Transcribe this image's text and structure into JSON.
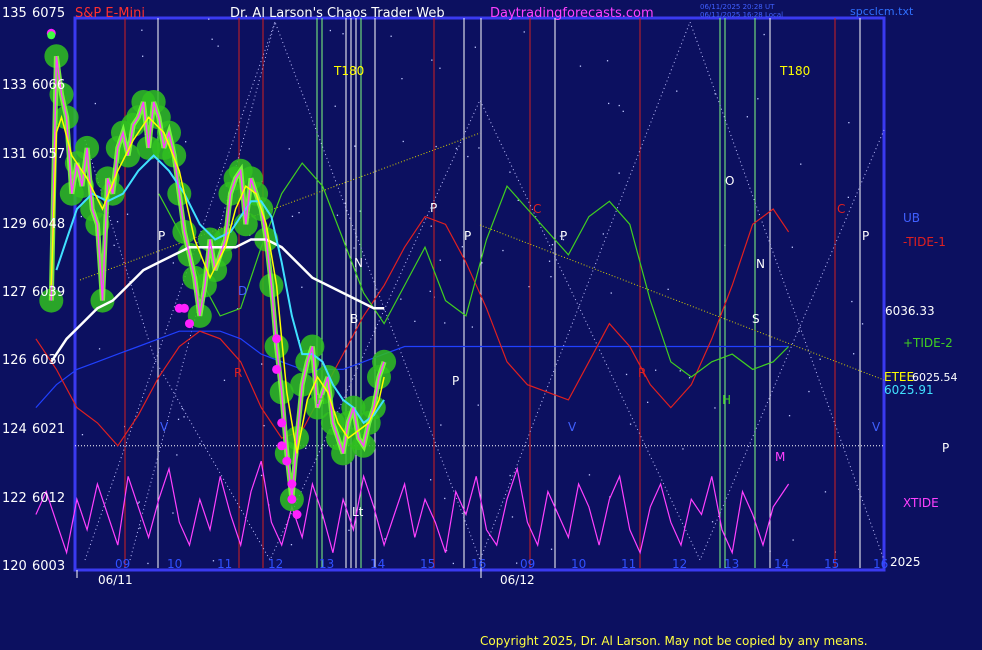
{
  "header": {
    "symbol": "S&P E-Mini",
    "title": "Dr. Al Larson's Chaos Trader Web",
    "site": "Daytradingforecasts.com",
    "stamp_line1": "06/11/2025 20:28 UT",
    "stamp_line2": "06/11/2025 16:28 Local",
    "file_name": "spcclcm.txt"
  },
  "colors": {
    "background": "#0c1060",
    "frame": "#3a3af0",
    "price": "#ff40ff",
    "ema_fast": "#ffff00",
    "ema_mid": "#40e0ff",
    "ema_slow": "#ffffff",
    "tide_minus": "#e02020",
    "tide_plus": "#40d020",
    "ub": "#2040ff",
    "xtide": "#ff40ff",
    "glow": "#30c020",
    "trendline": "#d8d000",
    "copyright": "#ffff40"
  },
  "chart_data": {
    "type": "line",
    "y_left_ticks": [
      "135",
      "133",
      "131",
      "129",
      "127",
      "126",
      "124",
      "122",
      "120"
    ],
    "y_price_ticks": [
      "6075",
      "6066",
      "6057",
      "6048",
      "6039",
      "6030",
      "6021",
      "6012",
      "6003"
    ],
    "ylim": [
      6003,
      6075
    ],
    "x_hour_labels_day1": [
      "09",
      "10",
      "11",
      "12",
      "13",
      "14",
      "15",
      "16"
    ],
    "x_hour_labels_day2": [
      "09",
      "10",
      "11",
      "12",
      "13",
      "14",
      "15",
      "16"
    ],
    "date_labels": [
      "06/11",
      "06/12"
    ],
    "series_labels": [
      "UB",
      "-TIDE-1",
      "+TIDE-2",
      "XTIDE"
    ],
    "value_labels": [
      "6036.33",
      "6025.91",
      "6025.54",
      "2025"
    ],
    "right_label_cluster": "ETEE",
    "marker_labels": [
      "T180",
      "T180",
      "P",
      "P",
      "P",
      "P",
      "P",
      "P",
      "C",
      "C",
      "O",
      "N",
      "N",
      "S",
      "R",
      "R",
      "B",
      "D",
      "H",
      "H",
      "V",
      "V",
      "V",
      "M",
      "P",
      "Lt"
    ],
    "price": {
      "x": [
        9.5,
        9.6,
        9.7,
        9.8,
        9.9,
        10.0,
        10.1,
        10.2,
        10.3,
        10.4,
        10.5,
        10.6,
        10.7,
        10.8,
        10.9,
        11.0,
        11.1,
        11.2,
        11.3,
        11.4,
        11.5,
        11.6,
        11.7,
        11.8,
        11.9,
        12.0,
        12.1,
        12.2,
        12.3,
        12.4,
        12.5,
        12.6,
        12.7,
        12.8,
        12.9,
        13.0,
        13.1,
        13.2,
        13.3,
        13.4,
        13.5,
        13.6,
        13.7,
        13.8,
        13.9,
        14.0,
        14.1,
        14.2,
        14.3,
        14.4,
        14.5,
        14.6,
        14.7,
        14.8,
        14.9,
        15.0,
        15.1,
        15.2,
        15.3,
        15.4,
        15.5,
        15.6,
        15.7,
        15.8,
        15.9,
        16.0
      ],
      "y": [
        6038,
        6070,
        6065,
        6062,
        6052,
        6056,
        6053,
        6058,
        6050,
        6048,
        6038,
        6054,
        6052,
        6058,
        6060,
        6057,
        6061,
        6062,
        6064,
        6058,
        6064,
        6062,
        6058,
        6060,
        6057,
        6052,
        6047,
        6044,
        6041,
        6036,
        6040,
        6046,
        6042,
        6044,
        6046,
        6052,
        6054,
        6055,
        6048,
        6054,
        6052,
        6050,
        6046,
        6040,
        6032,
        6026,
        6018,
        6012,
        6020,
        6027,
        6030,
        6032,
        6024,
        6026,
        6028,
        6022,
        6020,
        6018,
        6022,
        6024,
        6020,
        6019,
        6022,
        6024,
        6028,
        6030
      ]
    },
    "ema_fast": {
      "x": [
        9.5,
        9.6,
        9.7,
        9.9,
        10.2,
        10.5,
        10.8,
        11.1,
        11.4,
        11.7,
        12.0,
        12.3,
        12.6,
        12.9,
        13.1,
        13.3,
        13.5,
        13.7,
        13.9,
        14.1,
        14.3,
        14.5,
        14.7,
        14.9,
        15.1,
        15.3,
        15.5,
        15.7,
        15.9,
        16.0
      ],
      "y": [
        6040,
        6060,
        6062,
        6057,
        6054,
        6050,
        6055,
        6059,
        6062,
        6060,
        6055,
        6046,
        6041,
        6045,
        6050,
        6053,
        6052,
        6048,
        6040,
        6026,
        6018,
        6025,
        6028,
        6026,
        6022,
        6020,
        6021,
        6022,
        6025,
        6028
      ]
    },
    "ema_mid": {
      "x": [
        9.6,
        9.8,
        10.0,
        10.3,
        10.6,
        10.9,
        11.2,
        11.5,
        11.8,
        12.1,
        12.4,
        12.7,
        13.0,
        13.2,
        13.4,
        13.6,
        13.8,
        14.0,
        14.2,
        14.4,
        14.6,
        14.8,
        15.0,
        15.2,
        15.4,
        15.6,
        15.8,
        16.0
      ],
      "y": [
        6042,
        6046,
        6050,
        6052,
        6051,
        6052,
        6055,
        6057,
        6055,
        6052,
        6048,
        6046,
        6047,
        6049,
        6051,
        6051,
        6049,
        6043,
        6036,
        6031,
        6031,
        6030,
        6027,
        6025,
        6024,
        6022,
        6023,
        6025
      ]
    },
    "ema_slow": {
      "x": [
        9.5,
        9.8,
        10.1,
        10.4,
        10.7,
        11.0,
        11.3,
        11.6,
        11.9,
        12.2,
        12.5,
        12.8,
        13.1,
        13.4,
        13.7,
        14.0,
        14.3,
        14.6,
        14.9,
        15.2,
        15.5,
        15.8,
        16.0
      ],
      "y": [
        6030,
        6033,
        6035,
        6037,
        6038,
        6040,
        6042,
        6043,
        6044,
        6045,
        6045,
        6045,
        6045,
        6046,
        6046,
        6045,
        6043,
        6041,
        6040,
        6039,
        6038,
        6037,
        6037
      ]
    },
    "tide_minus": {
      "x": [
        9.2,
        9.6,
        10.0,
        10.4,
        10.8,
        11.2,
        11.6,
        12.0,
        12.4,
        12.8,
        13.2,
        13.6,
        14.0,
        14.4,
        14.8,
        15.2,
        15.6,
        16.0,
        16.4,
        16.8,
        17.2,
        17.6,
        18.0,
        18.4,
        18.8,
        19.2,
        19.6,
        20.0,
        20.4,
        20.8,
        21.2,
        21.6,
        22.0,
        22.4,
        22.8,
        23.2,
        23.6,
        23.9
      ],
      "y": [
        6033,
        6029,
        6024,
        6022,
        6019,
        6023,
        6028,
        6032,
        6034,
        6033,
        6030,
        6024,
        6020,
        6021,
        6026,
        6031,
        6036,
        6040,
        6045,
        6049,
        6048,
        6043,
        6037,
        6030,
        6027,
        6026,
        6025,
        6030,
        6035,
        6032,
        6027,
        6024,
        6027,
        6033,
        6040,
        6048,
        6050,
        6047
      ]
    },
    "tide_plus": {
      "x": [
        11.6,
        12.0,
        12.4,
        12.8,
        13.2,
        13.6,
        14.0,
        14.4,
        14.8,
        15.2,
        15.6,
        16.0,
        16.4,
        16.8,
        17.2,
        17.6,
        18.0,
        18.4,
        18.8,
        19.2,
        19.6,
        20.0,
        20.4,
        20.8,
        21.2,
        21.6,
        22.0,
        22.4,
        22.8,
        23.2,
        23.6,
        23.9
      ],
      "y": [
        6052,
        6047,
        6041,
        6036,
        6037,
        6045,
        6052,
        6056,
        6053,
        6046,
        6039,
        6035,
        6040,
        6045,
        6038,
        6036,
        6046,
        6053,
        6050,
        6047,
        6044,
        6049,
        6051,
        6048,
        6038,
        6030,
        6028,
        6030,
        6031,
        6029,
        6030,
        6032
      ]
    },
    "ub": {
      "x": [
        9.2,
        9.6,
        10.0,
        10.4,
        10.8,
        11.2,
        11.6,
        12.0,
        12.4,
        12.8,
        13.2,
        13.6,
        14.0,
        14.4,
        14.8,
        15.2,
        15.6,
        16.0,
        16.4,
        16.8,
        17.2,
        17.6,
        18.0,
        18.4,
        18.8,
        19.2,
        19.6,
        20.0,
        20.4,
        20.8,
        21.2,
        21.6,
        22.0,
        22.4,
        22.8,
        23.2,
        23.6,
        23.9
      ],
      "y": [
        6024,
        6027,
        6029,
        6030,
        6031,
        6032,
        6033,
        6034,
        6034,
        6034,
        6033,
        6031,
        6030,
        6029,
        6029,
        6029,
        6030,
        6031,
        6032,
        6032,
        6032,
        6032,
        6032,
        6032,
        6032,
        6032,
        6032,
        6032,
        6032,
        6032,
        6032,
        6032,
        6032,
        6032,
        6032,
        6032,
        6032,
        6032
      ]
    },
    "xtide": {
      "x": [
        9.2,
        9.4,
        9.6,
        9.8,
        10.0,
        10.2,
        10.4,
        10.6,
        10.8,
        11.0,
        11.2,
        11.4,
        11.6,
        11.8,
        12.0,
        12.2,
        12.4,
        12.6,
        12.8,
        13.0,
        13.2,
        13.4,
        13.6,
        13.8,
        14.0,
        14.2,
        14.4,
        14.6,
        14.8,
        15.0,
        15.2,
        15.4,
        15.6,
        15.8,
        16.0,
        16.2,
        16.4,
        16.6,
        16.8,
        17.0,
        17.2,
        17.4,
        17.6,
        17.8,
        18.0,
        18.2,
        18.4,
        18.6,
        18.8,
        19.0,
        19.2,
        19.4,
        19.6,
        19.8,
        20.0,
        20.2,
        20.4,
        20.6,
        20.8,
        21.0,
        21.2,
        21.4,
        21.6,
        21.8,
        22.0,
        22.2,
        22.4,
        22.6,
        22.8,
        23.0,
        23.2,
        23.4,
        23.6,
        23.9
      ],
      "y": [
        6010,
        6013,
        6009,
        6005,
        6012,
        6008,
        6014,
        6010,
        6006,
        6015,
        6011,
        6007,
        6012,
        6016,
        6009,
        6006,
        6012,
        6008,
        6015,
        6010,
        6006,
        6013,
        6017,
        6009,
        6006,
        6011,
        6007,
        6014,
        6010,
        6005,
        6012,
        6008,
        6015,
        6011,
        6006,
        6010,
        6014,
        6007,
        6012,
        6009,
        6005,
        6013,
        6010,
        6015,
        6008,
        6006,
        6012,
        6016,
        6009,
        6006,
        6013,
        6010,
        6007,
        6014,
        6011,
        6006,
        6012,
        6015,
        6008,
        6005,
        6011,
        6014,
        6009,
        6006,
        6012,
        6010,
        6015,
        6008,
        6005,
        6013,
        6010,
        6006,
        6011,
        6014
      ]
    },
    "magenta_dots": {
      "x": [
        9.5,
        12.0,
        12.1,
        12.2,
        13.9,
        13.9,
        14.0,
        14.0,
        14.1,
        14.2,
        14.2,
        14.3
      ],
      "y": [
        6073,
        6037,
        6037,
        6035,
        6033,
        6029,
        6022,
        6019,
        6017,
        6014,
        6012,
        6010
      ]
    },
    "reference_level": 6019
  }
}
